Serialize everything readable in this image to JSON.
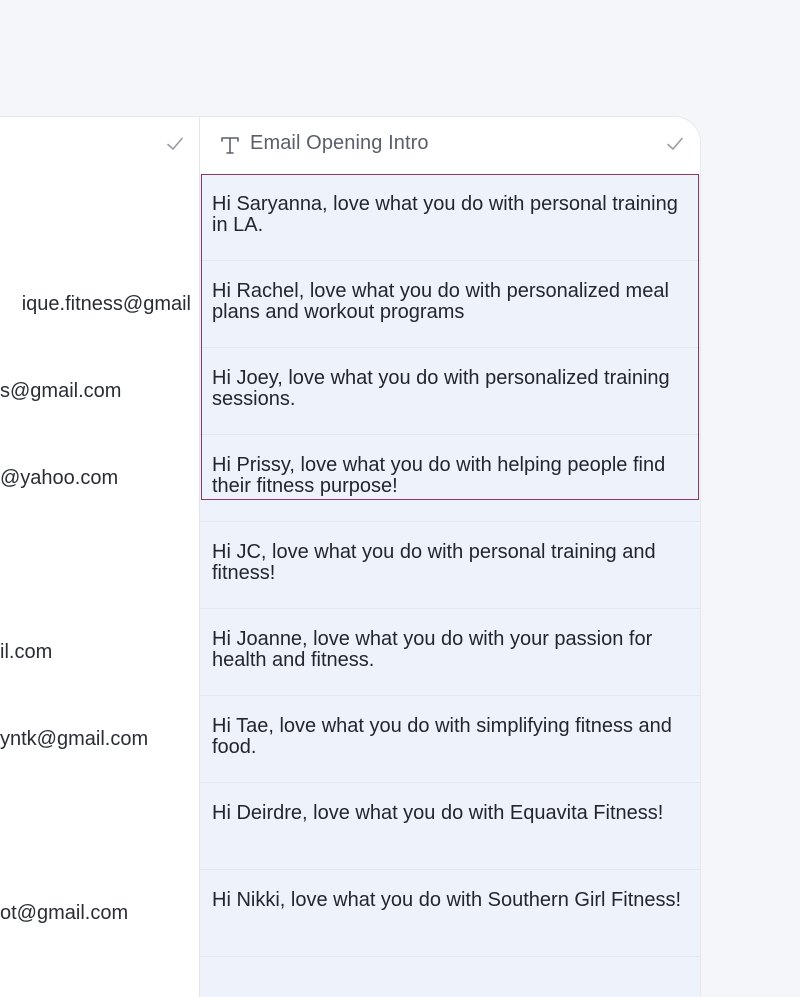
{
  "header": {
    "column_title": "Email Opening Intro",
    "type_icon": "text-type-icon",
    "status_icon": "check-icon"
  },
  "colors": {
    "selection_border": "#8a3a62",
    "intro_cell_bg": "#eef2fb"
  },
  "rows": [
    {
      "email": "",
      "intro": "Hi Saryanna, love what you do with personal training in LA."
    },
    {
      "email": "ique.fitness@gmail",
      "intro": "Hi Rachel, love what you do with personalized meal plans and workout programs"
    },
    {
      "email": "s@gmail.com",
      "intro": "Hi Joey, love what you do with personalized training sessions."
    },
    {
      "email": "@yahoo.com",
      "intro": "Hi Prissy, love what you do with helping people find their fitness purpose!"
    },
    {
      "email": "",
      "intro": "Hi JC, love what you do with personal training and fitness!"
    },
    {
      "email": "il.com",
      "intro": "Hi Joanne, love what you do with your passion for health and fitness."
    },
    {
      "email": "yntk@gmail.com",
      "intro": "Hi Tae, love what you do with simplifying fitness and food."
    },
    {
      "email": "",
      "intro": "Hi Deirdre, love what you do with Equavita Fitness!"
    },
    {
      "email": "ot@gmail.com",
      "intro": "Hi Nikki, love what you do with Southern Girl Fitness!"
    }
  ]
}
